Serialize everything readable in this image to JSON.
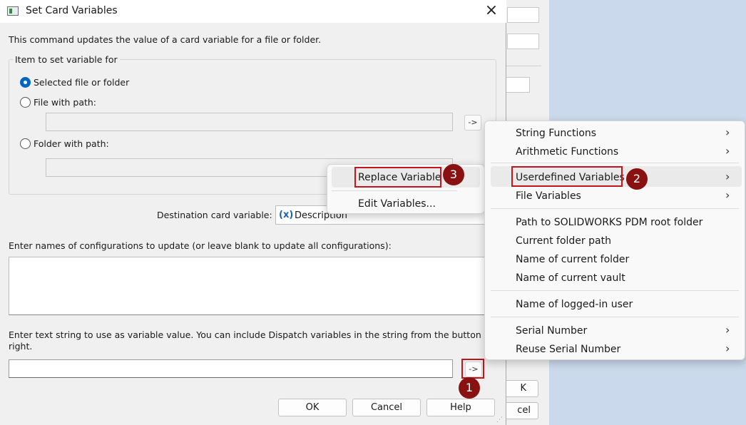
{
  "dialog": {
    "title": "Set Card Variables",
    "description": "This command updates the value of a card variable for a file or folder.",
    "group_label": "Item to set variable for",
    "radio_selected_label": "Selected file or folder",
    "radio_file_label": "File with path:",
    "radio_folder_label": "Folder with path:",
    "arrow_label": "->",
    "dest_label": "Destination card variable:",
    "dest_icon": "(x)",
    "dest_value": "Description",
    "config_label": "Enter names of configurations to update (or leave blank to update all configurations):",
    "value_label_line1": "Enter text string to use as variable value. You can include Dispatch variables in the string from the button to the",
    "value_label_line2": "right.",
    "ok_label": "OK",
    "cancel_label": "Cancel",
    "help_label": "Help"
  },
  "background_window": {
    "button1_label": "K",
    "button2_label": "cel"
  },
  "main_menu": {
    "items": [
      {
        "label": "String Functions",
        "submenu": true
      },
      {
        "label": "Arithmetic Functions",
        "submenu": true
      },
      {
        "label": "Userdefined Variables",
        "submenu": true
      },
      {
        "label": "File Variables",
        "submenu": true
      },
      {
        "label": "Path to SOLIDWORKS PDM root folder",
        "submenu": false
      },
      {
        "label": "Current folder path",
        "submenu": false
      },
      {
        "label": "Name of current folder",
        "submenu": false
      },
      {
        "label": "Name of current vault",
        "submenu": false
      },
      {
        "label": "Name of logged-in user",
        "submenu": false
      },
      {
        "label": "Serial Number",
        "submenu": true
      },
      {
        "label": "Reuse Serial Number",
        "submenu": true
      }
    ],
    "chevron": "›"
  },
  "sub_menu": {
    "items": [
      {
        "label": "Replace Variable"
      },
      {
        "label": "Edit Variables..."
      }
    ]
  },
  "callouts": [
    "1",
    "2",
    "3"
  ],
  "colors": {
    "accent": "#0067c0",
    "highlight_border": "#c0161e",
    "badge": "#8a1111",
    "desktop": "#cbd9ec"
  }
}
